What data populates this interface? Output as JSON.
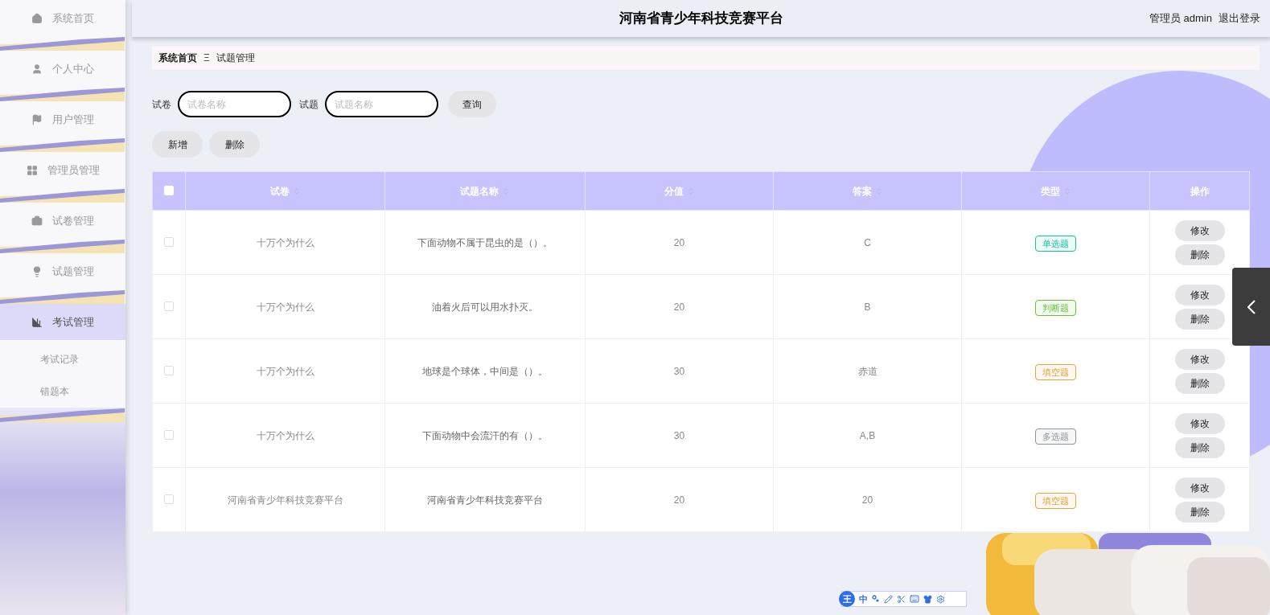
{
  "header": {
    "title": "河南省青少年科技竞赛平台",
    "user": "管理员 admin",
    "logout": "退出登录"
  },
  "sidebar": {
    "items": [
      {
        "label": "系统首页",
        "selected": false
      },
      {
        "label": "个人中心",
        "selected": false
      },
      {
        "label": "用户管理",
        "selected": false
      },
      {
        "label": "管理员管理",
        "selected": false
      },
      {
        "label": "试卷管理",
        "selected": false
      },
      {
        "label": "试题管理",
        "selected": false
      },
      {
        "label": "考试管理",
        "selected": true,
        "expanded": true,
        "children": [
          {
            "label": "考试记录"
          },
          {
            "label": "错题本"
          }
        ]
      }
    ]
  },
  "breadcrumb": {
    "home": "系统首页",
    "separator": "Ξ",
    "current": "试题管理"
  },
  "search": {
    "fields": [
      {
        "label": "试卷",
        "placeholder": "试卷名称"
      },
      {
        "label": "试题",
        "placeholder": "试题名称"
      }
    ],
    "button": "查询"
  },
  "actions": [
    "新增",
    "删除"
  ],
  "table": {
    "select_all_checked": false,
    "columns": [
      {
        "label": "试卷",
        "sortable": true
      },
      {
        "label": "试题名称",
        "sortable": true
      },
      {
        "label": "分值",
        "sortable": true
      },
      {
        "label": "答案",
        "sortable": true
      },
      {
        "label": "类型",
        "sortable": true
      },
      {
        "label": "操作",
        "sortable": false
      }
    ],
    "rows": [
      {
        "checked": false,
        "paper": "十万个为什么",
        "question": "下面动物不属于昆虫的是（）。",
        "score": "20",
        "answer": "C",
        "type": {
          "label": "单选题",
          "color": "#13c2a0"
        },
        "buttons": [
          "修改",
          "删除"
        ]
      },
      {
        "checked": false,
        "paper": "十万个为什么",
        "question": "油着火后可以用水扑灭。",
        "score": "20",
        "answer": "B",
        "type": {
          "label": "判断题",
          "color": "#67c23a"
        },
        "buttons": [
          "修改",
          "删除"
        ]
      },
      {
        "checked": false,
        "paper": "十万个为什么",
        "question": "地球是个球体，中间是（）。",
        "score": "30",
        "answer": "赤道",
        "type": {
          "label": "填空题",
          "color": "#e6a23c"
        },
        "buttons": [
          "修改",
          "删除"
        ]
      },
      {
        "checked": false,
        "paper": "十万个为什么",
        "question": "下面动物中会流汗的有（）。",
        "score": "30",
        "answer": "A,B",
        "type": {
          "label": "多选题",
          "color": "#909399"
        },
        "buttons": [
          "修改",
          "删除"
        ]
      },
      {
        "checked": false,
        "paper": "河南省青少年科技竞赛平台",
        "question": "河南省青少年科技竞赛平台",
        "score": "20",
        "answer": "20",
        "type": {
          "label": "填空题",
          "color": "#e6a23c"
        },
        "buttons": [
          "修改",
          "删除"
        ]
      }
    ]
  },
  "ime_toolbar": {
    "logo": "王",
    "mode": "中"
  }
}
